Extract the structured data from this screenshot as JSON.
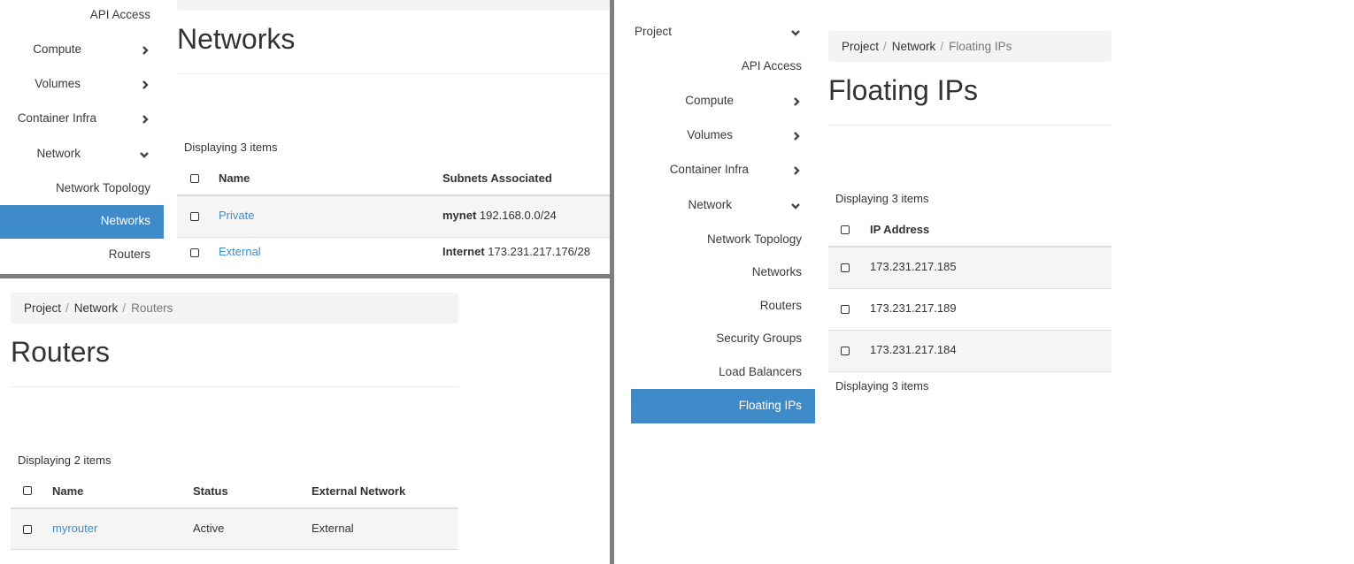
{
  "colors": {
    "accent": "#3f8ac8",
    "link": "#428bca",
    "divider": "#7f7f7f",
    "breadcrumb_bg": "#f4f4f4"
  },
  "networks_panel": {
    "sidebar": {
      "items": [
        {
          "label": "API Access"
        },
        {
          "label": "Compute",
          "icon": "chevron-right-icon"
        },
        {
          "label": "Volumes",
          "icon": "chevron-right-icon"
        },
        {
          "label": "Container Infra",
          "icon": "chevron-right-icon"
        },
        {
          "label": "Network",
          "icon": "chevron-down-icon"
        },
        {
          "label": "Network Topology"
        },
        {
          "label": "Networks",
          "active": true
        },
        {
          "label": "Routers"
        }
      ]
    },
    "title": "Networks",
    "count_label": "Displaying 3 items",
    "table": {
      "columns": [
        "Name",
        "Subnets Associated"
      ],
      "rows": [
        {
          "name": "Private",
          "subnet_name": "mynet",
          "subnet_cidr": "192.168.0.0/24"
        },
        {
          "name": "External",
          "subnet_name": "Internet",
          "subnet_cidr": "173.231.217.176/28"
        }
      ]
    }
  },
  "routers_panel": {
    "breadcrumb": {
      "items": [
        "Project",
        "Network"
      ],
      "separator": "/",
      "current": "Routers"
    },
    "title": "Routers",
    "count_label": "Displaying 2 items",
    "table": {
      "columns": [
        "Name",
        "Status",
        "External Network"
      ],
      "rows": [
        {
          "name": "myrouter",
          "status": "Active",
          "external_network": "External"
        }
      ]
    }
  },
  "floating_panel": {
    "sidebar": {
      "items": [
        {
          "label": "Project",
          "icon": "chevron-down-icon"
        },
        {
          "label": "API Access"
        },
        {
          "label": "Compute",
          "icon": "chevron-right-icon"
        },
        {
          "label": "Volumes",
          "icon": "chevron-right-icon"
        },
        {
          "label": "Container Infra",
          "icon": "chevron-right-icon"
        },
        {
          "label": "Network",
          "icon": "chevron-down-icon"
        },
        {
          "label": "Network Topology"
        },
        {
          "label": "Networks"
        },
        {
          "label": "Routers"
        },
        {
          "label": "Security Groups"
        },
        {
          "label": "Load Balancers"
        },
        {
          "label": "Floating IPs",
          "active": true
        }
      ]
    },
    "breadcrumb": {
      "items": [
        "Project",
        "Network"
      ],
      "separator": "/",
      "current": "Floating IPs"
    },
    "title": "Floating IPs",
    "count_label": "Displaying 3 items",
    "footer_count_label": "Displaying 3 items",
    "table": {
      "columns": [
        "IP Address"
      ],
      "rows": [
        {
          "ip": "173.231.217.185"
        },
        {
          "ip": "173.231.217.189"
        },
        {
          "ip": "173.231.217.184"
        }
      ]
    }
  }
}
